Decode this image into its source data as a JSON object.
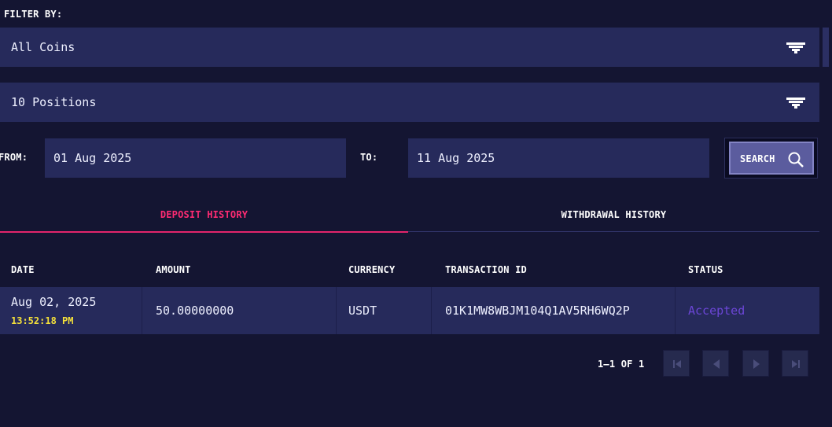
{
  "filter": {
    "label": "FILTER BY:",
    "coin_select": {
      "value": "All Coins",
      "icon": "chevron-down-icon"
    },
    "positions_select": {
      "value": "10 Positions",
      "icon": "chevron-down-icon"
    }
  },
  "date_range": {
    "from_label": "FROM:",
    "from_value": "01 Aug 2025",
    "to_label": "TO:",
    "to_value": "11 Aug 2025",
    "search_label": "SEARCH",
    "search_icon": "search-icon"
  },
  "tabs": [
    {
      "label": "DEPOSIT HISTORY",
      "active": true
    },
    {
      "label": "WITHDRAWAL HISTORY",
      "active": false
    }
  ],
  "table": {
    "headers": [
      "DATE",
      "AMOUNT",
      "CURRENCY",
      "TRANSACTION ID",
      "STATUS"
    ],
    "rows": [
      {
        "date": "Aug 02, 2025",
        "time": "13:52:18 PM",
        "amount": "50.00000000",
        "currency": "USDT",
        "transaction_id": "01K1MW8WBJM104Q1AV5RH6WQ2P",
        "status": "Accepted"
      }
    ]
  },
  "pagination": {
    "info": "1–1 OF 1",
    "buttons": [
      "first-page-icon",
      "prev-page-icon",
      "next-page-icon",
      "last-page-icon"
    ]
  },
  "colors": {
    "background": "#141532",
    "panel": "#262a5b",
    "tab_active": "#ff2b73",
    "time_text": "#f5e13a",
    "status_accepted": "#6b46d6",
    "search_button": "#5b5c9e"
  }
}
